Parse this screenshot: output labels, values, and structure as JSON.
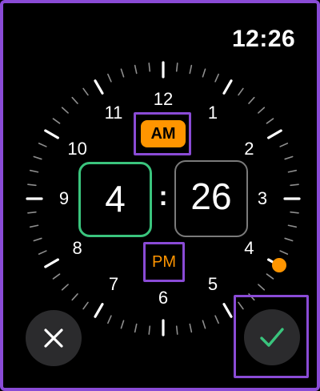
{
  "status_bar": {
    "time": "12:26"
  },
  "dial": {
    "hour_labels": [
      "12",
      "1",
      "2",
      "3",
      "4",
      "5",
      "6",
      "7",
      "8",
      "9",
      "10",
      "11"
    ],
    "selected_marker_color": "#ff9500"
  },
  "period_selector": {
    "am_label": "AM",
    "pm_label": "PM",
    "selected": "AM"
  },
  "time_picker": {
    "hour": "4",
    "separator": ":",
    "minute": "26",
    "active_field": "hour"
  },
  "actions": {
    "cancel_icon": "close-icon",
    "confirm_icon": "checkmark-icon"
  },
  "colors": {
    "accent": "#ff9500",
    "active_field_border": "#3ac47d",
    "confirm_check": "#3ac47d",
    "highlight_outline": "#8a4bd6"
  }
}
